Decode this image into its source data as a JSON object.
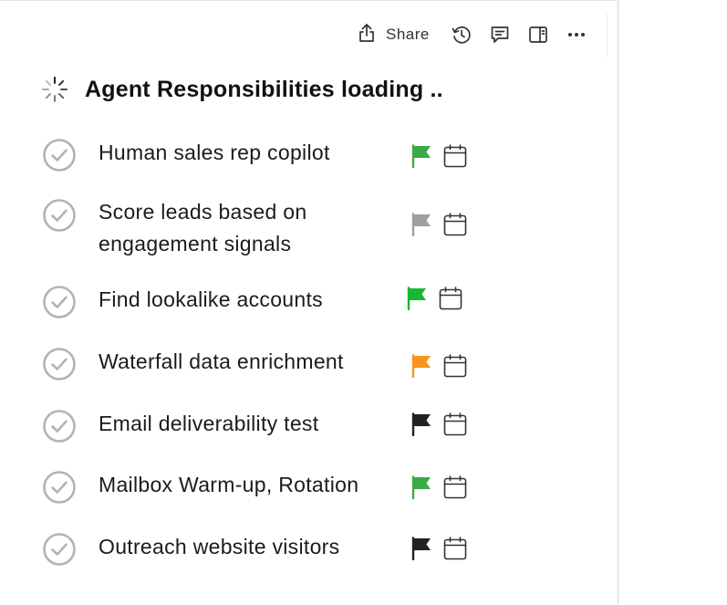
{
  "toolbar": {
    "share_label": "Share",
    "icons": [
      "share-icon",
      "history-icon",
      "comment-icon",
      "sidebar-toggle-icon",
      "more-icon"
    ]
  },
  "page": {
    "title": "Agent Responsibilities loading ..",
    "status_icon": "loading-spinner-icon"
  },
  "tasks": [
    {
      "label_lines": [
        "Human sales rep copilot"
      ],
      "flag_color": "#3aaa45"
    },
    {
      "label_lines": [
        "Score leads based on",
        "engagement signals"
      ],
      "flag_color": "#9e9e9e"
    },
    {
      "label_lines": [
        "Find lookalike accounts"
      ],
      "flag_color": "#18b832"
    },
    {
      "label_lines": [
        "Waterfall data enrichment"
      ],
      "flag_color": "#f5961d"
    },
    {
      "label_lines": [
        "Email deliverability test"
      ],
      "flag_color": "#222222"
    },
    {
      "label_lines": [
        "Mailbox Warm-up, Rotation"
      ],
      "flag_color": "#3aaa45"
    },
    {
      "label_lines": [
        "Outreach website visitors"
      ],
      "flag_color": "#222222"
    }
  ],
  "colors": {
    "check_circle": "#b3b3b3",
    "icon_stroke": "#333333"
  }
}
